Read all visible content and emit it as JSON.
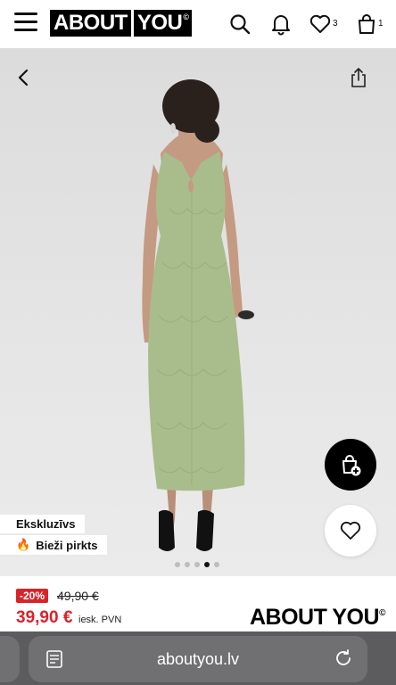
{
  "header": {
    "logo_part1": "ABOUT",
    "logo_part2": "YOU",
    "logo_mark": "©",
    "wishlist_count": "3",
    "cart_count": "1",
    "icons": [
      "menu-icon",
      "search-icon",
      "bell-icon",
      "heart-icon",
      "bag-icon"
    ]
  },
  "gallery": {
    "badges": {
      "exclusive": "Ekskluzīvs",
      "popular": "Bieži pirkts",
      "popular_icon": "🔥"
    },
    "dots_total": 5,
    "dots_active_index": 3,
    "colors": {
      "dress": "#a9bd8c",
      "background": "#e4e4e4"
    }
  },
  "price": {
    "discount": "-20%",
    "old": "49,90 €",
    "new": "39,90 €",
    "vat_note": "iesk. PVN",
    "discount_color": "#d8232a"
  },
  "brand": {
    "name": "ABOUT YOU",
    "mark": "©"
  },
  "browser": {
    "url": "aboutyou.lv"
  }
}
